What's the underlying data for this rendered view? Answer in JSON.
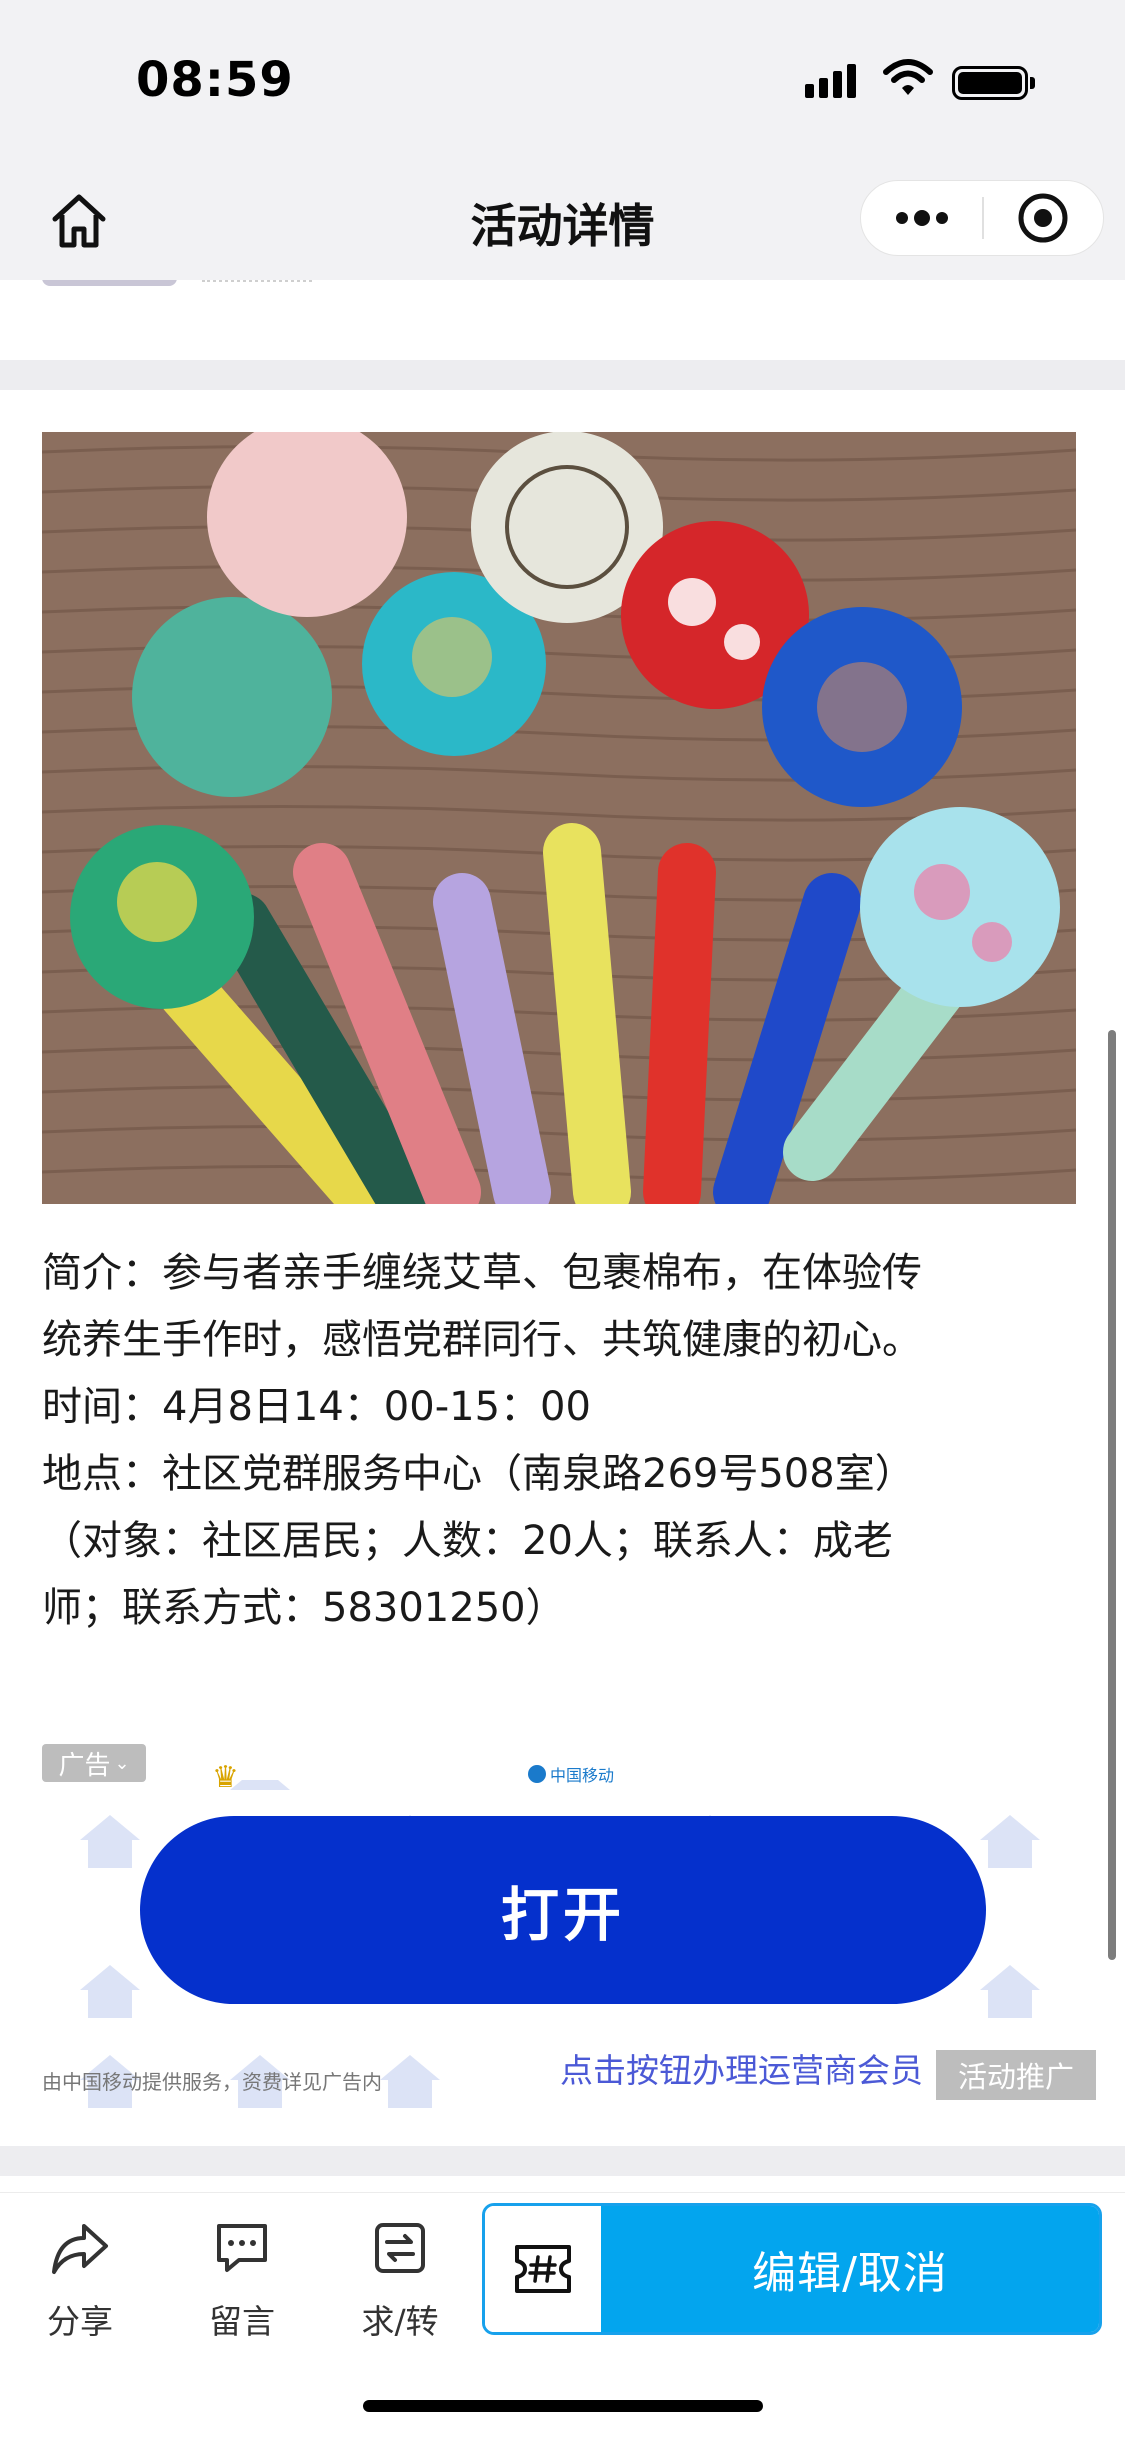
{
  "status_bar": {
    "time": "08:59"
  },
  "nav": {
    "title": "活动详情"
  },
  "activity": {
    "description_lines": [
      "简介：参与者亲手缠绕艾草、包裹棉布，在体验传",
      "统养生手作时，感悟党群同行、共筑健康的初心。",
      "时间：4月8日14：00-15：00",
      "地点：社区党群服务中心（南泉路269号508室）",
      "（对象：社区居民；人数：20人；联系人：成老",
      "师；联系方式：58301250）"
    ]
  },
  "ad": {
    "tag": "广告",
    "brand": "中国移动",
    "open_label": "打开",
    "disclaimer": "由中国移动提供服务，资费详见广告内",
    "hint": "点击按钮办理运营商会员",
    "promo_tag": "活动推广"
  },
  "bottom_bar": {
    "share_label": "分享",
    "comment_label": "留言",
    "transfer_label": "求/转",
    "action_label": "编辑/取消"
  },
  "colors": {
    "open_button": "#0530cc",
    "action_button": "#03a5ee",
    "action_border": "#17a1ec"
  }
}
